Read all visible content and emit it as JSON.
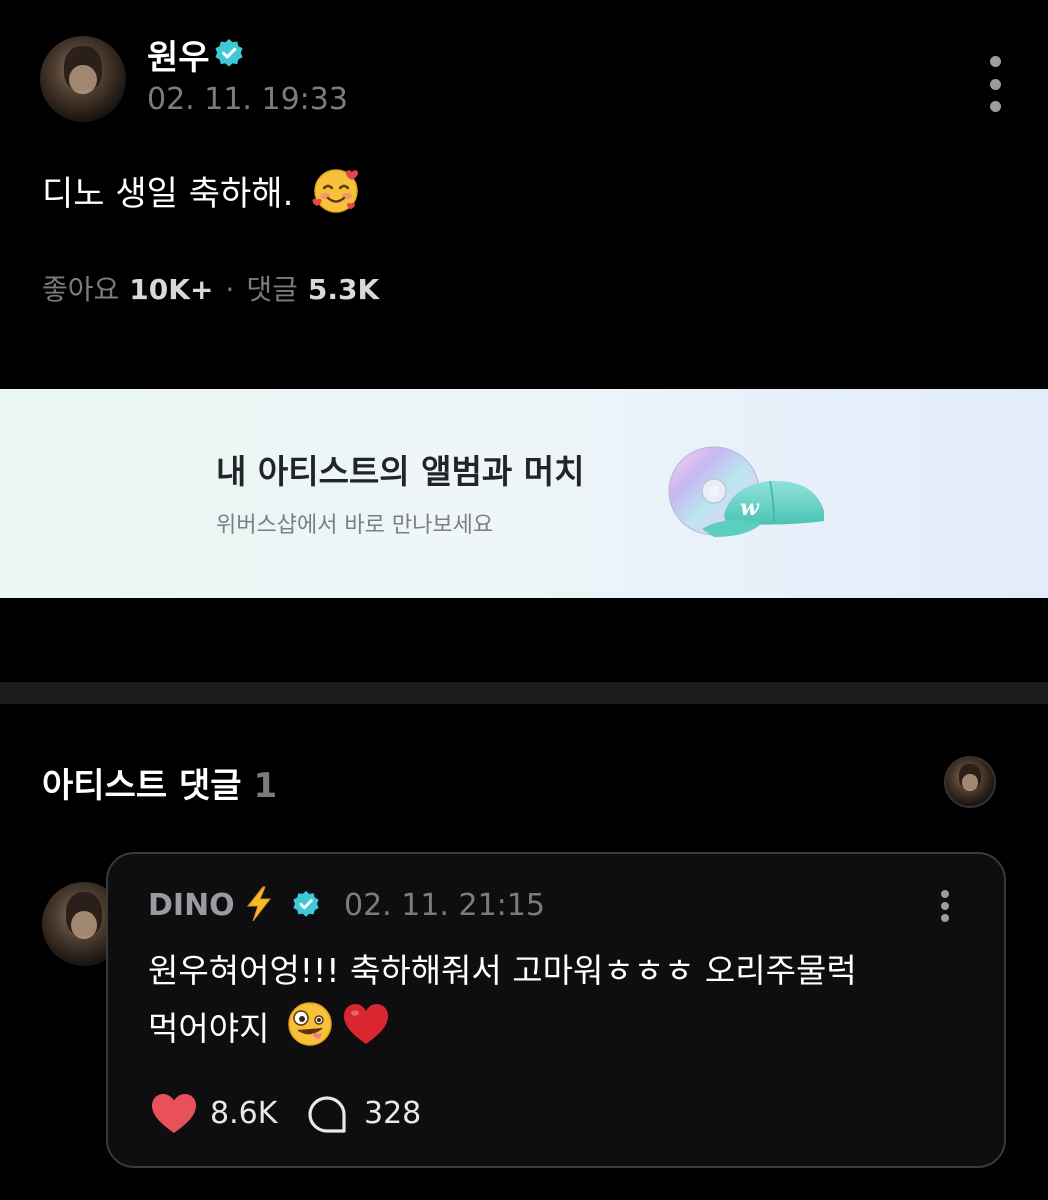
{
  "post": {
    "author": "원우",
    "date": "02. 11. 19:33",
    "text": "디노 생일 축하해.",
    "text_emoji": "smiling-face-with-hearts",
    "stats": {
      "likes_label": "좋아요",
      "likes_count": "10K+",
      "separator": "·",
      "comments_label": "댓글",
      "comments_count": "5.3K"
    }
  },
  "banner": {
    "title": "내 아티스트의 앨범과 머치",
    "subtitle": "위버스샵에서 바로 만나보세요",
    "art": "cd-and-cap-icon"
  },
  "artist_comments": {
    "title": "아티스트 댓글",
    "count": "1",
    "comment": {
      "author": "DINO",
      "author_emoji": "high-voltage",
      "date": "02. 11. 21:15",
      "line1": "원우혀어엉!!! 축하해줘서 고마워ㅎㅎㅎ 오리주물럭",
      "line2": "먹어야지",
      "line2_emojis": [
        "zany-face",
        "red-heart"
      ],
      "likes": "8.6K",
      "replies": "328"
    }
  },
  "colors": {
    "background": "#000000",
    "muted_text": "#7c7c80",
    "verified_badge": "#3ec9d6",
    "heart": "#e0464e",
    "card_border": "#3a3a3e"
  }
}
